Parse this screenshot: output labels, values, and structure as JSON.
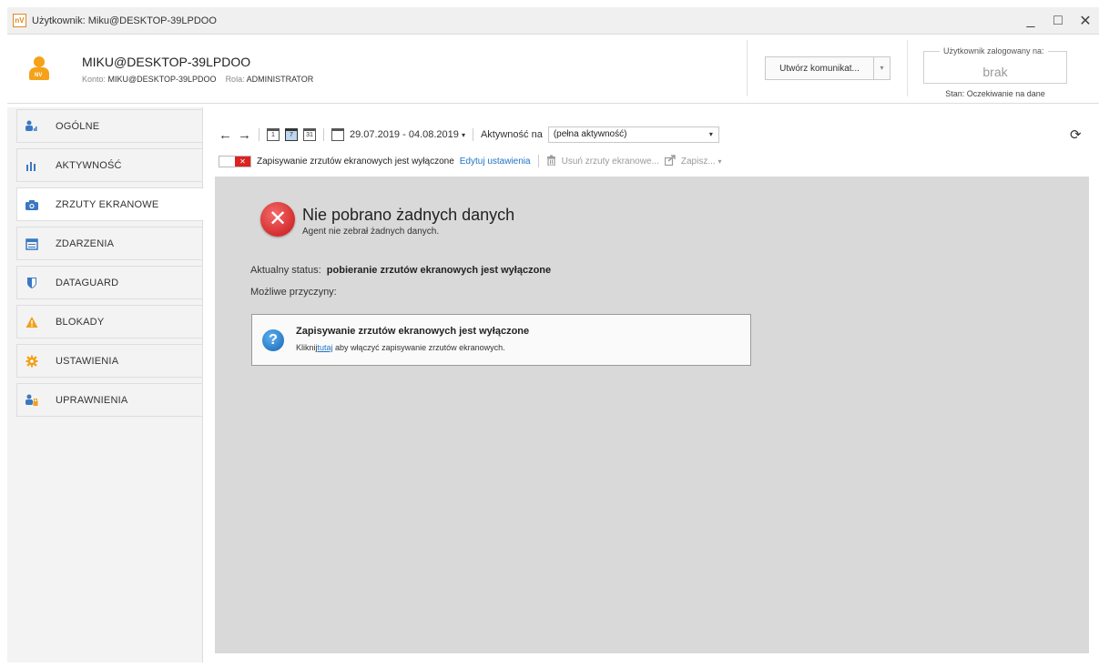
{
  "window": {
    "logo": "nV",
    "title": "Użytkownik: Miku@DESKTOP-39LPDOO",
    "minimize": "_",
    "maximize": "□",
    "close": "✕"
  },
  "header": {
    "user_name": "MIKU@DESKTOP-39LPDOO",
    "account_label": "Konto:",
    "account_value": "MIKU@DESKTOP-39LPDOO",
    "role_label": "Rola:",
    "role_value": "ADMINISTRATOR",
    "avatar_badge": "NV",
    "compose_button": "Utwórz komunikat...",
    "compose_dropdown": "▾",
    "logged_label": "Użytkownik zalogowany na:",
    "logged_value": "brak",
    "state": "Stan: Oczekiwanie na dane"
  },
  "sidebar": {
    "items": [
      {
        "label": "OGÓLNE",
        "icon": "user-chart-icon"
      },
      {
        "label": "AKTYWNOŚĆ",
        "icon": "bar-chart-icon"
      },
      {
        "label": "ZRZUTY EKRANOWE",
        "icon": "camera-icon",
        "active": true
      },
      {
        "label": "ZDARZENIA",
        "icon": "calendar-list-icon"
      },
      {
        "label": "DATAGUARD",
        "icon": "shield-icon"
      },
      {
        "label": "BLOKADY",
        "icon": "warning-icon"
      },
      {
        "label": "USTAWIENIA",
        "icon": "gear-icon"
      },
      {
        "label": "UPRAWNIENIA",
        "icon": "user-lock-icon"
      }
    ]
  },
  "toolbar": {
    "back": "←",
    "forward": "→",
    "cal_day": "1",
    "cal_week": "7",
    "cal_month": "31",
    "date_range": "29.07.2019 - 04.08.2019",
    "date_dropdown": "▾",
    "activity_label": "Aktywność na",
    "activity_value": "(pełna aktywność)",
    "activity_dropdown": "▾",
    "refresh": "⟳"
  },
  "toolbar2": {
    "toggle_x": "✕",
    "screenshots_off": "Zapisywanie zrzutów ekranowych jest wyłączone",
    "edit_settings": "Edytuj ustawienia",
    "delete_screens": "Usuń zrzuty ekranowe...",
    "save": "Zapisz...",
    "save_dropdown": "▾"
  },
  "content": {
    "error_glyph": "✕",
    "error_title": "Nie pobrano żadnych danych",
    "error_subtitle": "Agent nie zebrał żadnych danych.",
    "status_label": "Aktualny status:",
    "status_value": "pobieranie zrzutów ekranowych jest wyłączone",
    "reasons_label": "Możliwe przyczyny:",
    "reason_glyph": "?",
    "reason_title": "Zapisywanie zrzutów ekranowych jest wyłączone",
    "reason_pre": "Kliknij",
    "reason_link": "tutaj",
    "reason_post": "aby włączyć zapisywanie zrzutów ekranowych."
  }
}
